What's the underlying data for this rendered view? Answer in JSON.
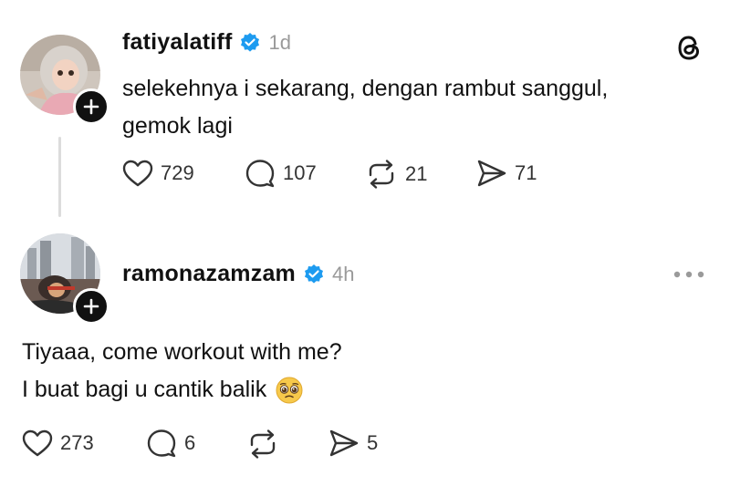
{
  "posts": [
    {
      "username": "fatiyalatiff",
      "time": "1d",
      "lines": [
        "selekehnya i sekarang, dengan rambut sanggul,",
        "gemok lagi"
      ],
      "likes": "729",
      "replies": "107",
      "reposts": "21",
      "shares": "71"
    },
    {
      "username": "ramonazamzam",
      "time": "4h",
      "lines": [
        "Tiyaaa, come workout with me?",
        "I buat bagi u cantik balik"
      ],
      "emoji": "🥹",
      "likes": "273",
      "replies": "6",
      "reposts": "",
      "shares": "5"
    }
  ],
  "icons": {
    "threads_logo": "threads-logo-icon",
    "verified": "verified-badge-icon",
    "like": "heart-icon",
    "reply": "comment-icon",
    "repost": "repost-icon",
    "share": "send-icon",
    "more": "more-options-icon",
    "follow": "plus-icon"
  },
  "colors": {
    "verified": "#1d9bf0",
    "muted": "#9a9a9a",
    "text": "#111111"
  }
}
